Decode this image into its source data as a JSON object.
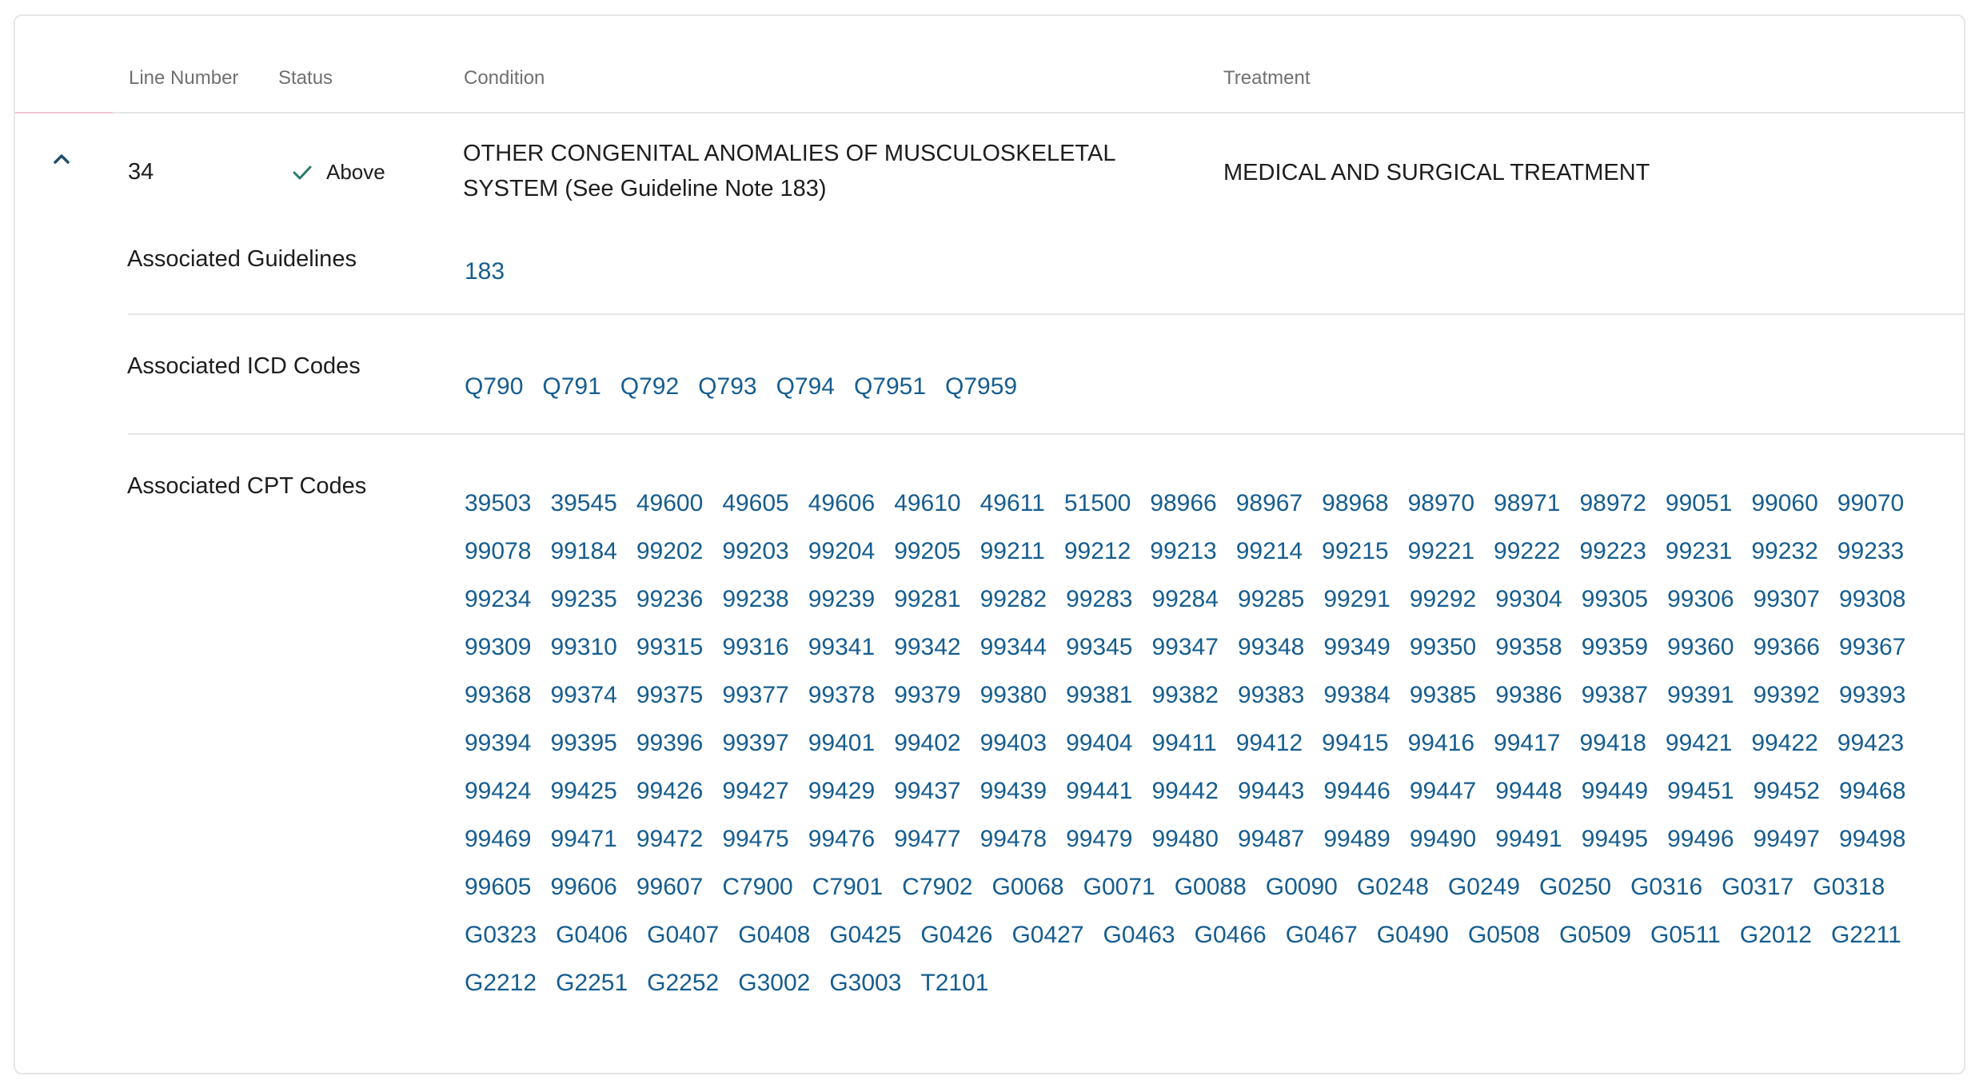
{
  "table": {
    "headers": {
      "line_number": "Line Number",
      "status": "Status",
      "condition": "Condition",
      "treatment": "Treatment"
    },
    "row": {
      "line_number": "34",
      "status": "Above",
      "condition": "OTHER CONGENITAL ANOMALIES OF MUSCULOSKELETAL SYSTEM (See Guideline Note 183)",
      "treatment": "MEDICAL AND SURGICAL TREATMENT"
    }
  },
  "details": {
    "guidelines_label": "Associated Guidelines",
    "guidelines": [
      "183"
    ],
    "icd_label": "Associated ICD Codes",
    "icd_codes": [
      "Q790",
      "Q791",
      "Q792",
      "Q793",
      "Q794",
      "Q7951",
      "Q7959"
    ],
    "cpt_label": "Associated CPT Codes",
    "cpt_codes": [
      "39503",
      "39545",
      "49600",
      "49605",
      "49606",
      "49610",
      "49611",
      "51500",
      "98966",
      "98967",
      "98968",
      "98970",
      "98971",
      "98972",
      "99051",
      "99060",
      "99070",
      "99078",
      "99184",
      "99202",
      "99203",
      "99204",
      "99205",
      "99211",
      "99212",
      "99213",
      "99214",
      "99215",
      "99221",
      "99222",
      "99223",
      "99231",
      "99232",
      "99233",
      "99234",
      "99235",
      "99236",
      "99238",
      "99239",
      "99281",
      "99282",
      "99283",
      "99284",
      "99285",
      "99291",
      "99292",
      "99304",
      "99305",
      "99306",
      "99307",
      "99308",
      "99309",
      "99310",
      "99315",
      "99316",
      "99341",
      "99342",
      "99344",
      "99345",
      "99347",
      "99348",
      "99349",
      "99350",
      "99358",
      "99359",
      "99360",
      "99366",
      "99367",
      "99368",
      "99374",
      "99375",
      "99377",
      "99378",
      "99379",
      "99380",
      "99381",
      "99382",
      "99383",
      "99384",
      "99385",
      "99386",
      "99387",
      "99391",
      "99392",
      "99393",
      "99394",
      "99395",
      "99396",
      "99397",
      "99401",
      "99402",
      "99403",
      "99404",
      "99411",
      "99412",
      "99415",
      "99416",
      "99417",
      "99418",
      "99421",
      "99422",
      "99423",
      "99424",
      "99425",
      "99426",
      "99427",
      "99429",
      "99437",
      "99439",
      "99441",
      "99442",
      "99443",
      "99446",
      "99447",
      "99448",
      "99449",
      "99451",
      "99452",
      "99468",
      "99469",
      "99471",
      "99472",
      "99475",
      "99476",
      "99477",
      "99478",
      "99479",
      "99480",
      "99487",
      "99489",
      "99490",
      "99491",
      "99495",
      "99496",
      "99497",
      "99498",
      "99605",
      "99606",
      "99607",
      "C7900",
      "C7901",
      "C7902",
      "G0068",
      "G0071",
      "G0088",
      "G0090",
      "G0248",
      "G0249",
      "G0250",
      "G0316",
      "G0317",
      "G0318",
      "G0323",
      "G0406",
      "G0407",
      "G0408",
      "G0425",
      "G0426",
      "G0427",
      "G0463",
      "G0466",
      "G0467",
      "G0490",
      "G0508",
      "G0509",
      "G0511",
      "G2012",
      "G2211",
      "G2212",
      "G2251",
      "G2252",
      "G3002",
      "G3003",
      "T2101"
    ]
  },
  "colors": {
    "link": "#165d8f",
    "check": "#2a7a6b",
    "accent": "#f2c6d4"
  },
  "icons": {
    "expand": "chevron-up-icon",
    "status": "check-icon"
  }
}
